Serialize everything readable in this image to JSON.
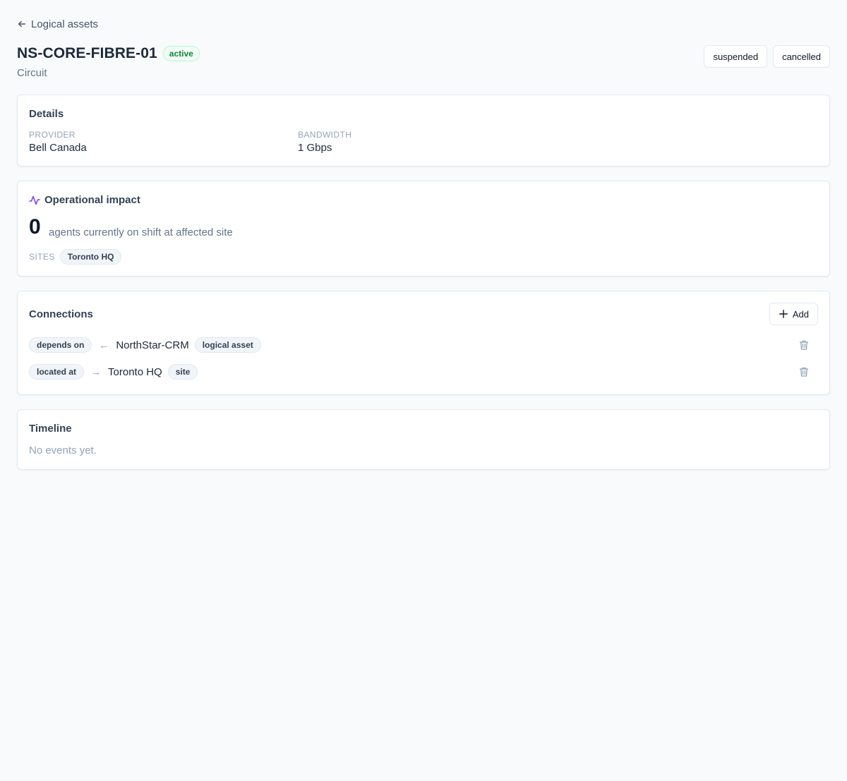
{
  "nav": {
    "back_label": "Logical assets"
  },
  "header": {
    "title": "NS-CORE-FIBRE-01",
    "status": "active",
    "subtitle": "Circuit",
    "actions": [
      "suspended",
      "cancelled"
    ]
  },
  "details": {
    "title": "Details",
    "fields": [
      {
        "label": "PROVIDER",
        "value": "Bell Canada"
      },
      {
        "label": "BANDWIDTH",
        "value": "1 Gbps"
      }
    ]
  },
  "impact": {
    "title": "Operational impact",
    "count": "0",
    "description": "agents currently on shift at affected site",
    "sites_label": "SITES",
    "sites": [
      "Toronto HQ"
    ]
  },
  "connections": {
    "title": "Connections",
    "add_label": "Add",
    "items": [
      {
        "relation": "depends on",
        "direction": "←",
        "target": "NorthStar-CRM",
        "kind": "logical asset"
      },
      {
        "relation": "located at",
        "direction": "→",
        "target": "Toronto HQ",
        "kind": "site"
      }
    ]
  },
  "timeline": {
    "title": "Timeline",
    "empty": "No events yet."
  },
  "colors": {
    "accent_purple": "#7c3aed",
    "status_green": "#15803d",
    "background": "#f8fafc"
  }
}
